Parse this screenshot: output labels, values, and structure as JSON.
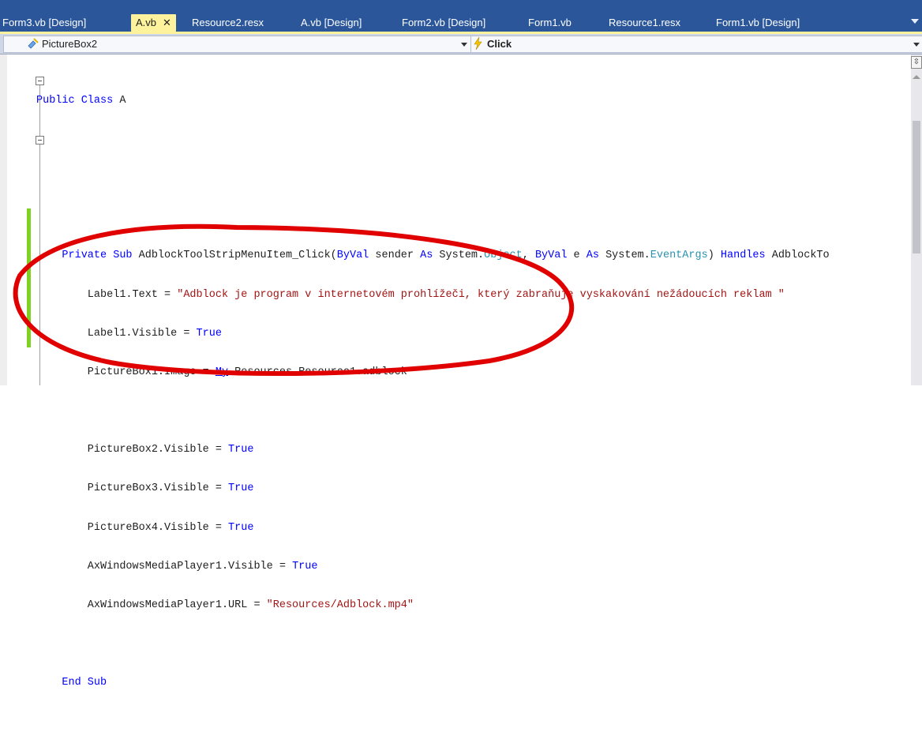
{
  "tabs": [
    {
      "label": "Form3.vb [Design]",
      "active": false
    },
    {
      "label": "A.vb",
      "active": true,
      "close": "✕"
    },
    {
      "label": "Resource2.resx",
      "active": false
    },
    {
      "label": "A.vb [Design]",
      "active": false
    },
    {
      "label": "Form2.vb [Design]",
      "active": false
    },
    {
      "label": "Form1.vb",
      "active": false
    },
    {
      "label": "Resource1.resx",
      "active": false
    },
    {
      "label": "Form1.vb [Design]",
      "active": false
    }
  ],
  "nav": {
    "object_combo": "PictureBox2",
    "object_icon": "control-object-icon",
    "event_combo": "Click",
    "event_icon": "event-lightning-icon"
  },
  "code_lines": [
    "Public Class A",
    "",
    "",
    "",
    "Private Sub AdblockToolStripMenuItem_Click(ByVal sender As System.Object, ByVal e As System.EventArgs) Handles AdblockTo",
    "Label1.Text = \"Adblock je program v internetovém prohlížeči, který zabraňuje vyskakování nežádoucích reklam \"",
    "Label1.Visible = True",
    "PictureBox1.Image = My.Resources.Resource1.adblock",
    "",
    "PictureBox2.Visible = True",
    "PictureBox3.Visible = True",
    "PictureBox4.Visible = True",
    "AxWindowsMediaPlayer1.Visible = True",
    "AxWindowsMediaPlayer1.URL = \"Resources/Adblock.mp4\"",
    "",
    "End Sub"
  ],
  "colors": {
    "tab_strip": "#2b579a",
    "active_tab": "#fff29d",
    "keyword": "#0000ff",
    "type": "#2b91af",
    "string": "#a31515",
    "change_marker": "#7ed321",
    "annotation": "#e00000"
  },
  "annotation": "red-ellipse-highlight"
}
